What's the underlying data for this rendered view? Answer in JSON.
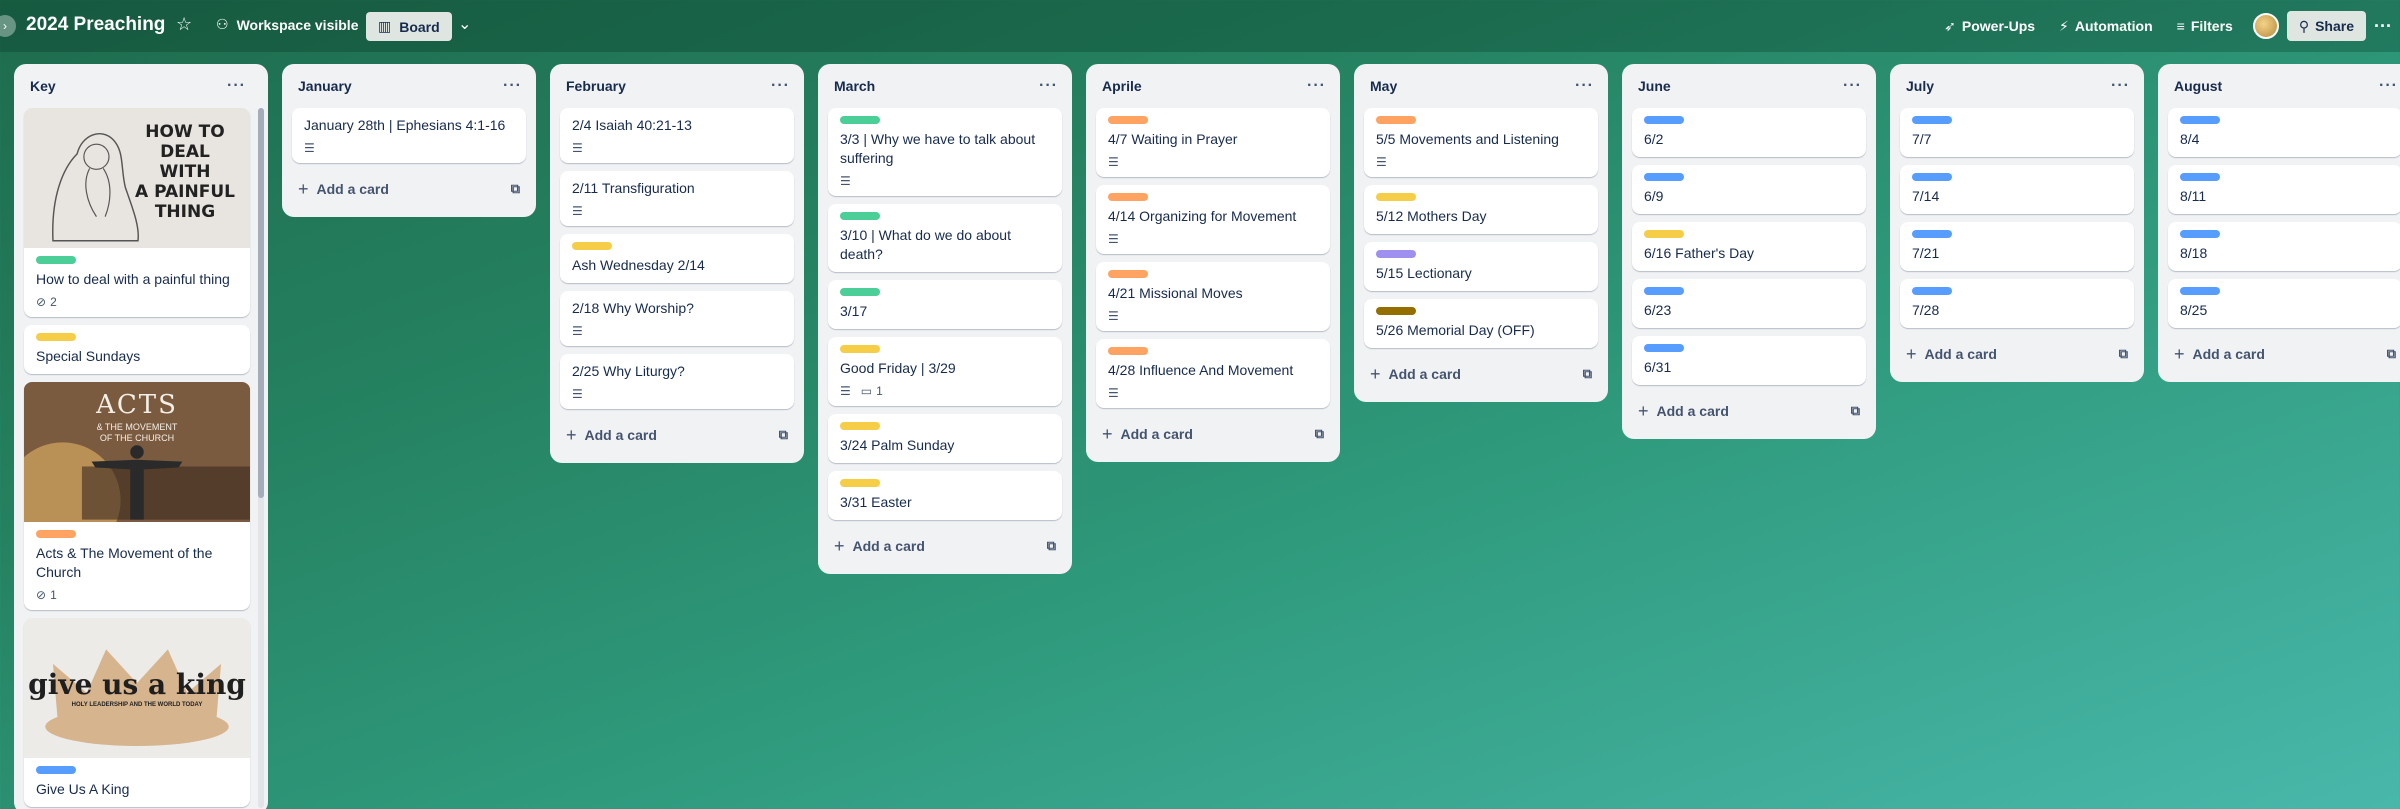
{
  "header": {
    "title": "2024 Preaching",
    "visibility": "Workspace visible",
    "view": "Board",
    "powerups": "Power-Ups",
    "automation": "Automation",
    "filters": "Filters",
    "share": "Share"
  },
  "labels": {
    "green": "#4bce97",
    "yellow": "#f5cd47",
    "orange": "#fea362",
    "blue": "#579dff",
    "purple": "#9f8fef",
    "brown": "#946f00"
  },
  "lists": {
    "key": {
      "title": "Key",
      "cards": [
        {
          "cover_lines": [
            "HOW TO",
            "DEAL",
            "WITH",
            "A PAINFUL",
            "THING"
          ],
          "label": "green",
          "title": "How to deal with a painful thing",
          "attachments": "2"
        },
        {
          "label": "yellow",
          "title": "Special Sundays"
        },
        {
          "cover_lines": [
            "ACTS",
            "& THE MOVEMENT",
            "OF THE CHURCH"
          ],
          "label": "orange",
          "title": "Acts & The Movement of the Church",
          "attachments": "1"
        },
        {
          "cover_lines": [
            "give us a king",
            "HOLY LEADERSHIP AND THE WORLD TODAY"
          ],
          "label": "blue",
          "title": "Give Us A King"
        }
      ]
    },
    "january": {
      "title": "January",
      "cards": [
        {
          "title": "January 28th | Ephesians 4:1-16"
        }
      ]
    },
    "february": {
      "title": "February",
      "cards": [
        {
          "title": "2/4 Isaiah 40:21-13"
        },
        {
          "title": "2/11 Transfiguration"
        },
        {
          "label": "yellow",
          "title": "Ash Wednesday 2/14"
        },
        {
          "title": "2/18 Why Worship?"
        },
        {
          "title": "2/25 Why Liturgy?"
        }
      ]
    },
    "march": {
      "title": "March",
      "cards": [
        {
          "label": "green",
          "title": "3/3 | Why we have to talk about suffering"
        },
        {
          "label": "green",
          "title": "3/10 | What do we do about death?"
        },
        {
          "label": "green",
          "title": "3/17"
        },
        {
          "label": "yellow",
          "title": "Good Friday | 3/29",
          "comments": "1"
        },
        {
          "label": "yellow",
          "title": "3/24 Palm Sunday"
        },
        {
          "label": "yellow",
          "title": "3/31 Easter"
        }
      ]
    },
    "april": {
      "title": "Aprile",
      "cards": [
        {
          "label": "orange",
          "title": "4/7 Waiting in Prayer"
        },
        {
          "label": "orange",
          "title": "4/14 Organizing for Movement"
        },
        {
          "label": "orange",
          "title": "4/21 Missional Moves"
        },
        {
          "label": "orange",
          "title": "4/28 Influence And Movement"
        }
      ]
    },
    "may": {
      "title": "May",
      "cards": [
        {
          "label": "orange",
          "title": "5/5 Movements and Listening"
        },
        {
          "label": "yellow",
          "title": "5/12 Mothers Day"
        },
        {
          "label": "purple",
          "title": "5/15 Lectionary"
        },
        {
          "label": "brown",
          "title": "5/26 Memorial Day (OFF)"
        }
      ]
    },
    "june": {
      "title": "June",
      "cards": [
        {
          "label": "blue",
          "title": "6/2"
        },
        {
          "label": "blue",
          "title": "6/9"
        },
        {
          "label": "yellow",
          "title": "6/16 Father's Day"
        },
        {
          "label": "blue",
          "title": "6/23"
        },
        {
          "label": "blue",
          "title": "6/31"
        }
      ]
    },
    "july": {
      "title": "July",
      "cards": [
        {
          "label": "blue",
          "title": "7/7"
        },
        {
          "label": "blue",
          "title": "7/14"
        },
        {
          "label": "blue",
          "title": "7/21"
        },
        {
          "label": "blue",
          "title": "7/28"
        }
      ]
    },
    "august": {
      "title": "August",
      "cards": [
        {
          "label": "blue",
          "title": "8/4"
        },
        {
          "label": "blue",
          "title": "8/11"
        },
        {
          "label": "blue",
          "title": "8/18"
        },
        {
          "label": "blue",
          "title": "8/25"
        }
      ]
    },
    "add_card_label": "Add a card"
  }
}
